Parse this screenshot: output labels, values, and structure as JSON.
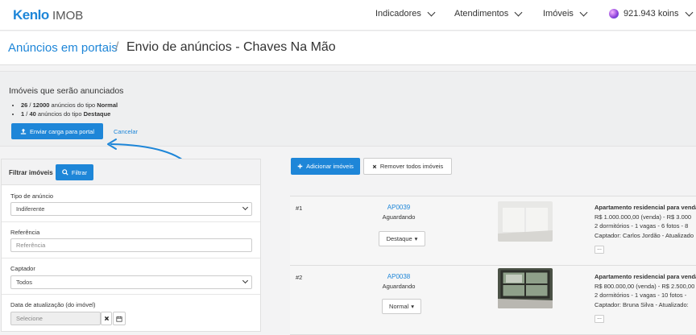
{
  "nav": {
    "logo_main": "Kenlo",
    "logo_sub": "IMOB",
    "items": [
      "Indicadores",
      "Atendimentos",
      "Imóveis"
    ],
    "koins": "921.943 koins"
  },
  "breadcrumb": {
    "parent": "Anúncios em portais",
    "separator": "/",
    "current": "Envio de anúncios - Chaves Na Mão"
  },
  "summary": {
    "title": "Imóveis que serão anunciados",
    "normal": {
      "used": "26",
      "sep": " / ",
      "total": "12000",
      "text": " anúncios do tipo ",
      "type": "Normal"
    },
    "destaque": {
      "used": "1",
      "sep": " / ",
      "total": "40",
      "text": " anúncios do tipo ",
      "type": "Destaque"
    },
    "send_button": "Enviar carga para portal",
    "cancel_link": "Cancelar"
  },
  "filter": {
    "title": "Filtrar imóveis",
    "button": "Filtrar",
    "tipo_label": "Tipo de anúncio",
    "tipo_value": "Indiferente",
    "ref_label": "Referência",
    "ref_placeholder": "Referência",
    "captador_label": "Captador",
    "captador_value": "Todos",
    "data_label": "Data de atualização (do imóvel)",
    "data_placeholder": "Selecione"
  },
  "actions": {
    "add": "Adicionar imóveis",
    "remove_all": "Remover todos imóveis"
  },
  "listings": [
    {
      "num": "#1",
      "code": "AP0039",
      "status": "Aguardando",
      "type": "Destaque",
      "title": "Apartamento residencial para venda",
      "price": "R$ 1.000.000,00 (venda) - R$ 3.000",
      "details": "2 dormitórios - 1 vagas - 6 fotos - 8",
      "captador": "Captador: Carlos Jordão - Atualizado"
    },
    {
      "num": "#2",
      "code": "AP0038",
      "status": "Aguardando",
      "type": "Normal",
      "title": "Apartamento residencial para venda",
      "price": "R$ 800.000,00 (venda) - R$ 2.500,00",
      "details": "2 dormitórios - 1 vagas - 10 fotos -",
      "captador": "Captador: Bruna Silva - Atualizado:"
    }
  ],
  "icons": {
    "chevron": "chevron-down-icon",
    "koin": "koin-coin-icon",
    "upload": "upload-icon",
    "search": "search-icon",
    "plus": "plus-icon",
    "times": "times-icon",
    "calendar": "calendar-icon"
  },
  "colors": {
    "brand": "#1e86d8"
  }
}
